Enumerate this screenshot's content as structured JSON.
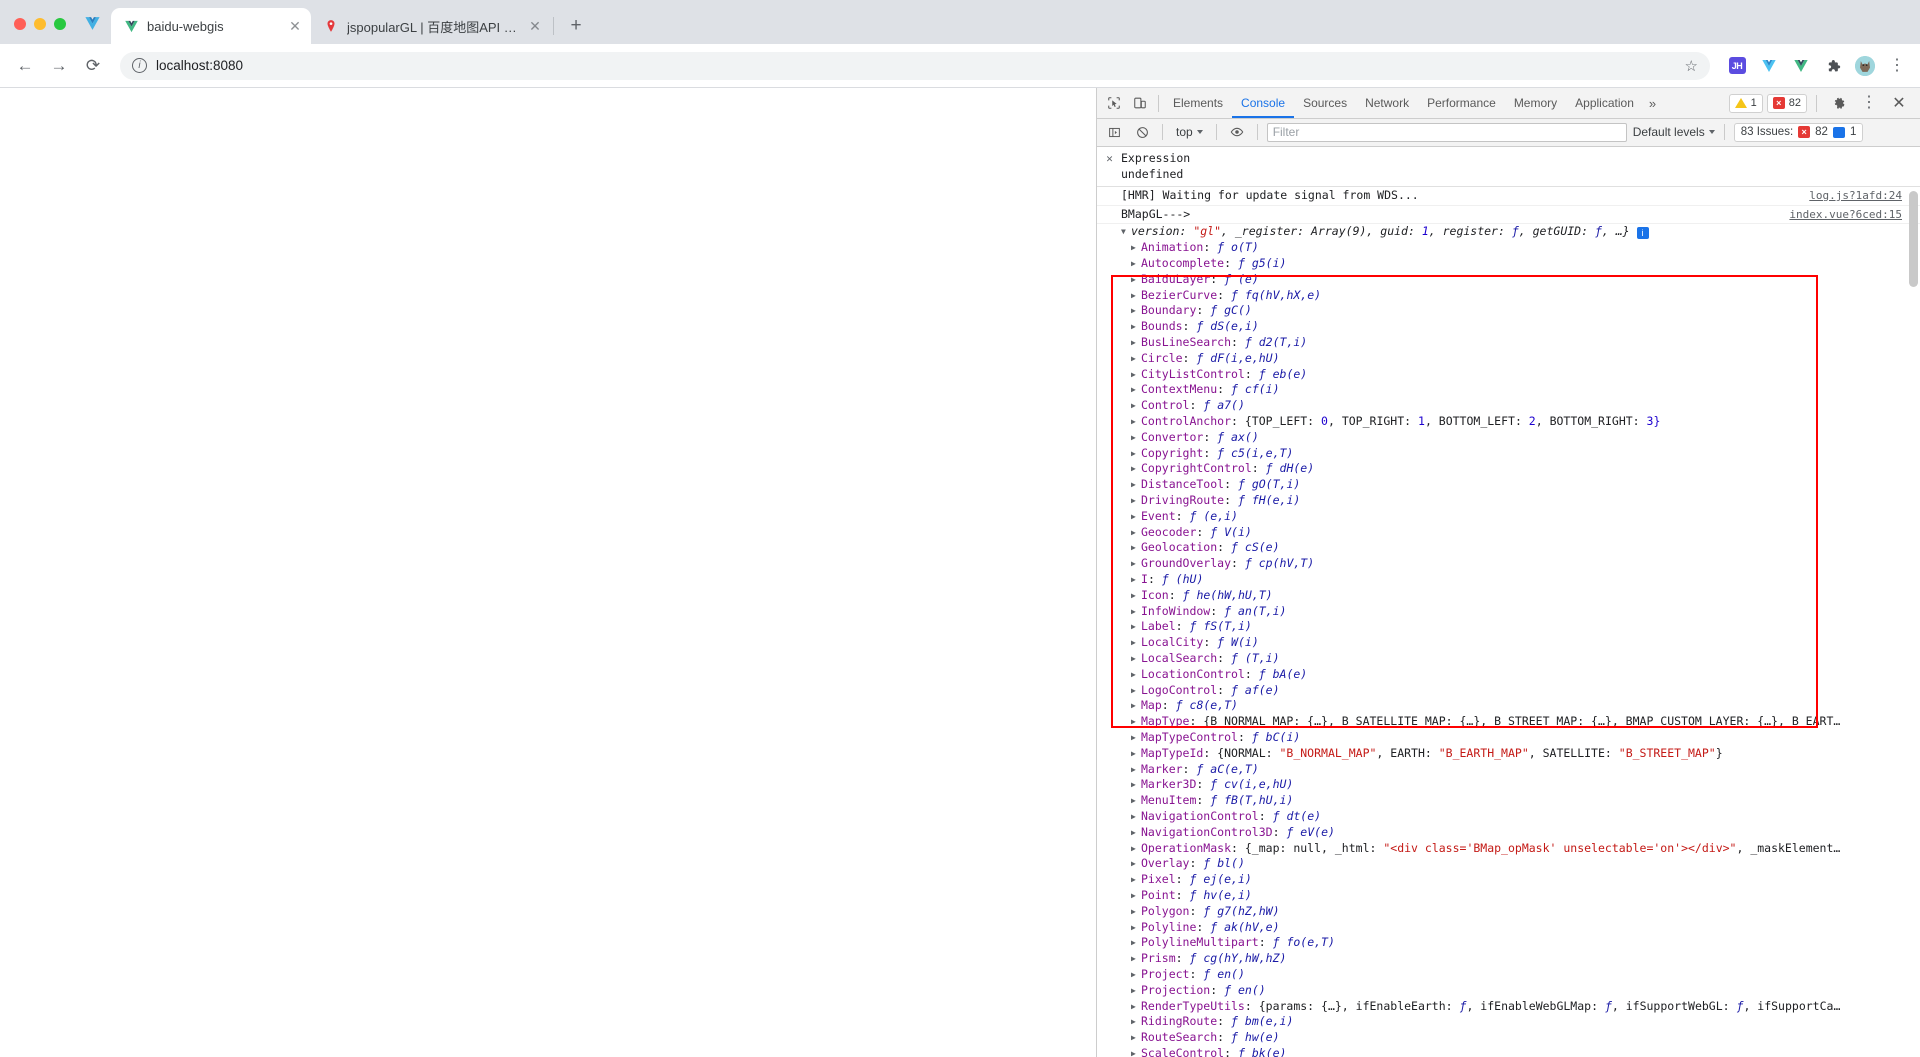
{
  "browser": {
    "tabs": [
      {
        "title": "baidu-webgis",
        "favicon": "vue-icon",
        "active": true,
        "close_label": "✕"
      },
      {
        "title": "jspopularGL | 百度地图API SDK",
        "favicon": "baidu-pin-icon",
        "active": false,
        "close_label": "✕"
      }
    ],
    "new_tab_label": "+",
    "nav": {
      "back": "←",
      "forward": "→",
      "reload": "⟳"
    },
    "omnibox": {
      "value": "localhost:8080",
      "info_icon": "i",
      "star_icon": "☆"
    },
    "extensions": [
      {
        "name": "jh-extension-icon",
        "label": "JH"
      },
      {
        "name": "baidu-extension-icon",
        "label": ""
      },
      {
        "name": "vue-devtools-icon",
        "label": ""
      },
      {
        "name": "puzzle-extensions-icon",
        "label": ""
      }
    ],
    "profile_label": "",
    "menu_label": "⋮"
  },
  "devtools": {
    "tabs": [
      {
        "label": "Elements",
        "active": false
      },
      {
        "label": "Console",
        "active": true
      },
      {
        "label": "Sources",
        "active": false
      },
      {
        "label": "Network",
        "active": false
      },
      {
        "label": "Performance",
        "active": false
      },
      {
        "label": "Memory",
        "active": false
      },
      {
        "label": "Application",
        "active": false
      }
    ],
    "more_tabs_label": "»",
    "warning_count": "1",
    "error_count": "82",
    "settings_label": "",
    "dock_label": "⋮",
    "close_label": "✕",
    "filterbar": {
      "sidebar_toggle": "show-console-sidebar-icon",
      "clear_label": "clear-console-icon",
      "context": "top",
      "eye_label": "live-expression-icon",
      "filter_placeholder": "Filter",
      "filter_value": "",
      "levels": "Default levels",
      "issues_text": "83 Issues:",
      "issues_errors": "82",
      "issues_info": "1"
    },
    "live_expression": {
      "close": "✕",
      "name": "Expression",
      "value": "undefined"
    },
    "messages": [
      {
        "text": "[HMR] Waiting for update signal from WDS...",
        "source": "log.js?1afd:24"
      },
      {
        "text": "BMapGL--->",
        "source": "index.vue?6ced:15"
      }
    ],
    "object_header": {
      "prefix": "{",
      "parts": [
        {
          "t": "version: ",
          "c": "plain"
        },
        {
          "t": "\"gl\"",
          "c": "str"
        },
        {
          "t": ", _register: ",
          "c": "plain"
        },
        {
          "t": "Array(9)",
          "c": "plain"
        },
        {
          "t": ", guid: ",
          "c": "plain"
        },
        {
          "t": "1",
          "c": "num"
        },
        {
          "t": ", register: ",
          "c": "plain"
        },
        {
          "t": "ƒ",
          "c": "fnkw"
        },
        {
          "t": ", getGUID: ",
          "c": "plain"
        },
        {
          "t": "ƒ",
          "c": "fnkw"
        },
        {
          "t": ", …}",
          "c": "plain"
        }
      ],
      "badge": "i"
    },
    "properties": [
      {
        "key": "Animation",
        "val": "o(T)",
        "kind": "fn"
      },
      {
        "key": "Autocomplete",
        "val": "g5(i)",
        "kind": "fn"
      },
      {
        "key": "BaiduLayer",
        "val": "(e)",
        "kind": "fn"
      },
      {
        "key": "BezierCurve",
        "val": "fq(hV,hX,e)",
        "kind": "fn"
      },
      {
        "key": "Boundary",
        "val": "gC()",
        "kind": "fn"
      },
      {
        "key": "Bounds",
        "val": "dS(e,i)",
        "kind": "fn"
      },
      {
        "key": "BusLineSearch",
        "val": "d2(T,i)",
        "kind": "fn"
      },
      {
        "key": "Circle",
        "val": "dF(i,e,hU)",
        "kind": "fn"
      },
      {
        "key": "CityListControl",
        "val": "eb(e)",
        "kind": "fn"
      },
      {
        "key": "ContextMenu",
        "val": "cf(i)",
        "kind": "fn"
      },
      {
        "key": "Control",
        "val": "a7()",
        "kind": "fn"
      },
      {
        "key": "ControlAnchor",
        "val": "",
        "kind": "obj",
        "segments": [
          {
            "t": "{TOP_LEFT: ",
            "c": "plain"
          },
          {
            "t": "0",
            "c": "num"
          },
          {
            "t": ", TOP_RIGHT: ",
            "c": "plain"
          },
          {
            "t": "1",
            "c": "num"
          },
          {
            "t": ", BOTTOM_LEFT: ",
            "c": "plain"
          },
          {
            "t": "2",
            "c": "num"
          },
          {
            "t": ", BOTTOM_RIGHT: ",
            "c": "plain"
          },
          {
            "t": "3}",
            "c": "num"
          }
        ]
      },
      {
        "key": "Convertor",
        "val": "ax()",
        "kind": "fn"
      },
      {
        "key": "Copyright",
        "val": "c5(i,e,T)",
        "kind": "fn"
      },
      {
        "key": "CopyrightControl",
        "val": "dH(e)",
        "kind": "fn"
      },
      {
        "key": "DistanceTool",
        "val": "gO(T,i)",
        "kind": "fn"
      },
      {
        "key": "DrivingRoute",
        "val": "fH(e,i)",
        "kind": "fn"
      },
      {
        "key": "Event",
        "val": "(e,i)",
        "kind": "fn"
      },
      {
        "key": "Geocoder",
        "val": "V(i)",
        "kind": "fn"
      },
      {
        "key": "Geolocation",
        "val": "cS(e)",
        "kind": "fn"
      },
      {
        "key": "GroundOverlay",
        "val": "cp(hV,T)",
        "kind": "fn"
      },
      {
        "key": "I",
        "val": "(hU)",
        "kind": "fn"
      },
      {
        "key": "Icon",
        "val": "he(hW,hU,T)",
        "kind": "fn"
      },
      {
        "key": "InfoWindow",
        "val": "an(T,i)",
        "kind": "fn"
      },
      {
        "key": "Label",
        "val": "fS(T,i)",
        "kind": "fn"
      },
      {
        "key": "LocalCity",
        "val": "W(i)",
        "kind": "fn"
      },
      {
        "key": "LocalSearch",
        "val": "(T,i)",
        "kind": "fn"
      },
      {
        "key": "LocationControl",
        "val": "bA(e)",
        "kind": "fn"
      },
      {
        "key": "LogoControl",
        "val": "af(e)",
        "kind": "fn"
      },
      {
        "key": "Map",
        "val": "c8(e,T)",
        "kind": "fn"
      },
      {
        "key": "MapType",
        "val": "",
        "kind": "obj",
        "segments": [
          {
            "t": "{B_NORMAL_MAP: {…}, B_SATELLITE_MAP: {…}, B_STREET_MAP: {…}, BMAP_CUSTOM_LAYER: {…}, B_EART…",
            "c": "plain"
          }
        ]
      },
      {
        "key": "MapTypeControl",
        "val": "bC(i)",
        "kind": "fn"
      },
      {
        "key": "MapTypeId",
        "val": "",
        "kind": "obj",
        "segments": [
          {
            "t": "{NORMAL: ",
            "c": "plain"
          },
          {
            "t": "\"B_NORMAL_MAP\"",
            "c": "str"
          },
          {
            "t": ", EARTH: ",
            "c": "plain"
          },
          {
            "t": "\"B_EARTH_MAP\"",
            "c": "str"
          },
          {
            "t": ", SATELLITE: ",
            "c": "plain"
          },
          {
            "t": "\"B_STREET_MAP\"",
            "c": "str"
          },
          {
            "t": "}",
            "c": "plain"
          }
        ]
      },
      {
        "key": "Marker",
        "val": "aC(e,T)",
        "kind": "fn"
      },
      {
        "key": "Marker3D",
        "val": "cv(i,e,hU)",
        "kind": "fn"
      },
      {
        "key": "MenuItem",
        "val": "fB(T,hU,i)",
        "kind": "fn"
      },
      {
        "key": "NavigationControl",
        "val": "dt(e)",
        "kind": "fn"
      },
      {
        "key": "NavigationControl3D",
        "val": "eV(e)",
        "kind": "fn"
      },
      {
        "key": "OperationMask",
        "val": "",
        "kind": "obj",
        "segments": [
          {
            "t": "{_map: null, _html: ",
            "c": "plain"
          },
          {
            "t": "\"<div class='BMap_opMask' unselectable='on'></div>\"",
            "c": "str"
          },
          {
            "t": ", _maskElement…",
            "c": "plain"
          }
        ]
      },
      {
        "key": "Overlay",
        "val": "bl()",
        "kind": "fn"
      },
      {
        "key": "Pixel",
        "val": "ej(e,i)",
        "kind": "fn"
      },
      {
        "key": "Point",
        "val": "hv(e,i)",
        "kind": "fn"
      },
      {
        "key": "Polygon",
        "val": "g7(hZ,hW)",
        "kind": "fn"
      },
      {
        "key": "Polyline",
        "val": "ak(hV,e)",
        "kind": "fn"
      },
      {
        "key": "PolylineMultipart",
        "val": "fo(e,T)",
        "kind": "fn"
      },
      {
        "key": "Prism",
        "val": "cg(hY,hW,hZ)",
        "kind": "fn"
      },
      {
        "key": "Project",
        "val": "en()",
        "kind": "fn"
      },
      {
        "key": "Projection",
        "val": "en()",
        "kind": "fn"
      },
      {
        "key": "RenderTypeUtils",
        "val": "",
        "kind": "obj",
        "segments": [
          {
            "t": "{params: {…}, ifEnableEarth: ",
            "c": "plain"
          },
          {
            "t": "ƒ",
            "c": "fnkw"
          },
          {
            "t": ", ifEnableWebGLMap: ",
            "c": "plain"
          },
          {
            "t": "ƒ",
            "c": "fnkw"
          },
          {
            "t": ", ifSupportWebGL: ",
            "c": "plain"
          },
          {
            "t": "ƒ",
            "c": "fnkw"
          },
          {
            "t": ", ifSupportCa…",
            "c": "plain"
          }
        ]
      },
      {
        "key": "RidingRoute",
        "val": "bm(e,i)",
        "kind": "fn"
      },
      {
        "key": "RouteSearch",
        "val": "hw(e)",
        "kind": "fn"
      },
      {
        "key": "ScaleControl",
        "val": "bk(e)",
        "kind": "fn"
      }
    ]
  },
  "annotation": {
    "highlight_color": "#ff0000"
  }
}
